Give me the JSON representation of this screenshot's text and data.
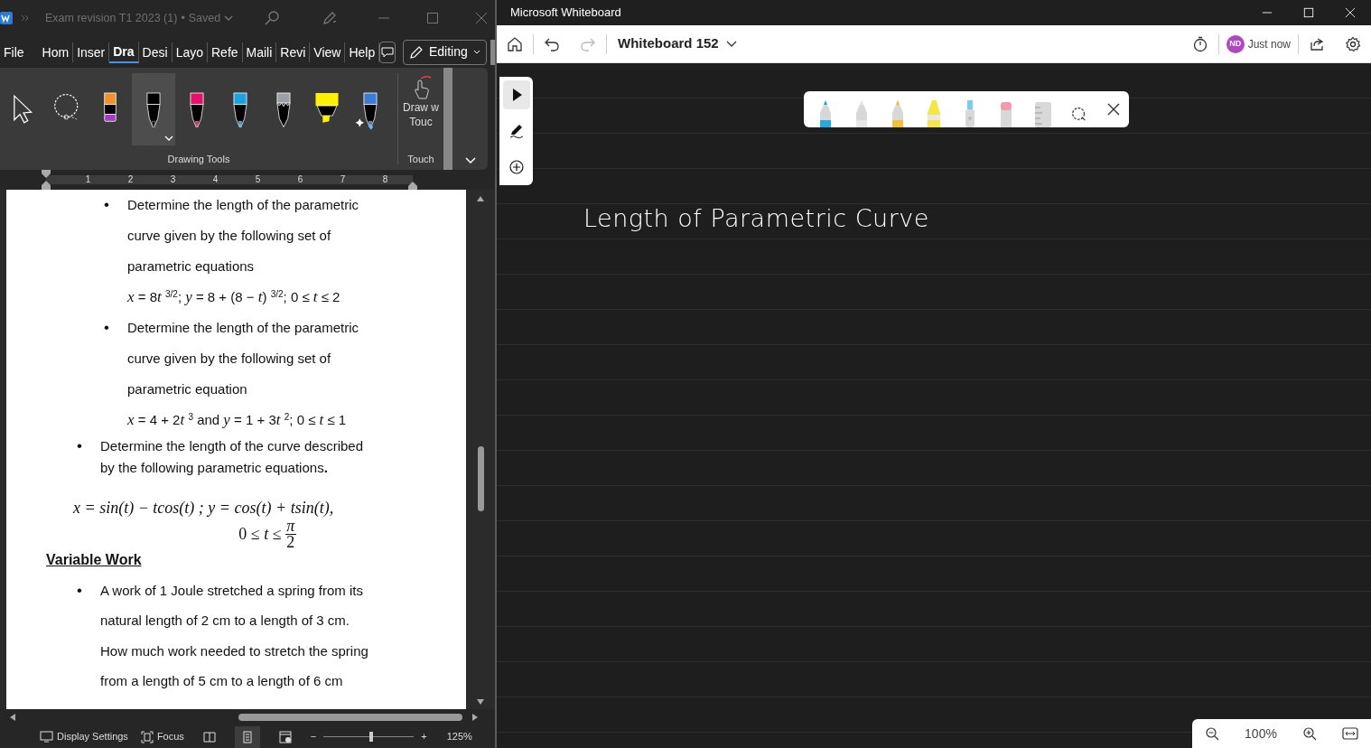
{
  "word": {
    "title": "Exam revision T1 2023 (1)",
    "separator": "•",
    "save_state": "Saved",
    "tabs": [
      {
        "label": "File",
        "selected": false
      },
      {
        "label": "Hom",
        "selected": false
      },
      {
        "label": "Inser",
        "selected": false
      },
      {
        "label": "Dra",
        "selected": true
      },
      {
        "label": "Desi",
        "selected": false
      },
      {
        "label": "Layo",
        "selected": false
      },
      {
        "label": "Refe",
        "selected": false
      },
      {
        "label": "Maili",
        "selected": false
      },
      {
        "label": "Revi",
        "selected": false
      },
      {
        "label": "View",
        "selected": false
      },
      {
        "label": "Help",
        "selected": false
      }
    ],
    "editing_button": "Editing",
    "tools": [
      {
        "kind": "select",
        "selected": false
      },
      {
        "kind": "lasso",
        "selected": false
      },
      {
        "kind": "eraser",
        "selected": false
      },
      {
        "kind": "pen",
        "color": "#000000",
        "selected": true
      },
      {
        "kind": "pen",
        "color": "#e8106a",
        "selected": false
      },
      {
        "kind": "pen",
        "color": "#1aa3e0",
        "selected": false
      },
      {
        "kind": "pencil",
        "color": "#9aa0a6",
        "selected": false
      },
      {
        "kind": "highlighter",
        "color": "#fff200",
        "selected": false
      },
      {
        "kind": "action_pen",
        "color": "#3a7bd5",
        "selected": false
      }
    ],
    "drawing_tools_label": "Drawing Tools",
    "touch_button_lines": [
      "Draw w",
      "Touc"
    ],
    "touch_group_label": "Touch",
    "ruler_numbers": [
      "1",
      "2",
      "3",
      "4",
      "5",
      "6",
      "7",
      "8"
    ],
    "document": [
      {
        "kind": "sublist",
        "items": [
          {
            "bullet": "•",
            "lines": [
              "Determine the length of the parametric",
              "curve given by the following set of",
              "parametric equations",
              [
                {
                  "text": "x",
                  "italic": true
                },
                {
                  "text": " = 8"
                },
                {
                  "text": "t ",
                  "italic": true
                },
                {
                  "text": "3/2",
                  "raised": true
                },
                {
                  "text": "; "
                },
                {
                  "text": "y",
                  "italic": true
                },
                {
                  "text": " = 8 + (8 − "
                },
                {
                  "text": "t",
                  "italic": true
                },
                {
                  "text": ") "
                },
                {
                  "text": "3/2",
                  "raised": true
                },
                {
                  "text": "; 0 ≤ "
                },
                {
                  "text": "t",
                  "italic": true
                },
                {
                  "text": " ≤ 2"
                }
              ]
            ]
          },
          {
            "bullet": "•",
            "lines": [
              "Determine the length of the parametric",
              "curve given by the following set of",
              "parametric equation",
              [
                {
                  "text": "x",
                  "italic": true
                },
                {
                  "text": " = 4 + 2"
                },
                {
                  "text": "t ",
                  "italic": true
                },
                {
                  "text": "3",
                  "raised": true
                },
                {
                  "text": " and "
                },
                {
                  "text": "y",
                  "italic": true
                },
                {
                  "text": " = 1 + 3"
                },
                {
                  "text": "t ",
                  "italic": true
                },
                {
                  "text": "2",
                  "raised": true
                },
                {
                  "text": "; 0 ≤ "
                },
                {
                  "text": "t",
                  "italic": true
                },
                {
                  "text": " ≤ 1"
                }
              ]
            ]
          }
        ]
      },
      {
        "kind": "compact_bullet",
        "bullet": "•",
        "lines": [
          "Determine the length of the curve described",
          "by the following parametric equations**.**"
        ]
      },
      {
        "kind": "equation",
        "line": "*x* = *sin*(*t*) − *tcos*(*t*) ;  *y* = *cos*(*t*) + *tsin*(*t*),",
        "range": "0 ≤ *t* ≤",
        "numerator": "π",
        "denominator": "2"
      },
      {
        "kind": "heading",
        "text": "Variable Work"
      },
      {
        "kind": "bullet",
        "bullet": "•",
        "lines": [
          "A work of 1 Joule stretched a spring from its",
          "natural length of 2 cm to a length of 3 cm.",
          "How much work needed to stretch the spring",
          "from a length of 5 cm to a length of 6 cm"
        ]
      }
    ],
    "status": {
      "display_settings": "Display Settings",
      "focus": "Focus",
      "views": [
        {
          "kind": "read",
          "selected": false
        },
        {
          "kind": "print",
          "selected": true
        },
        {
          "kind": "web",
          "selected": false
        }
      ],
      "zoom_out": "−",
      "zoom_in": "+",
      "zoom": {
        "level": 0.53
      },
      "zoom_text": "125%"
    }
  },
  "whiteboard": {
    "title": "Microsoft Whiteboard",
    "board_name": "Whiteboard 152",
    "history": [
      {
        "kind": "undo",
        "disabled": false
      },
      {
        "kind": "redo",
        "disabled": true
      }
    ],
    "avatar": "ND",
    "saved": "Just now",
    "side_tools": [
      {
        "kind": "select",
        "selected": true
      },
      {
        "kind": "pen",
        "selected": false
      },
      {
        "kind": "add",
        "selected": false
      }
    ],
    "tray": [
      {
        "kind": "pen",
        "color": "#29a8e0"
      },
      {
        "kind": "pen",
        "color": "#e6e6e6"
      },
      {
        "kind": "pen",
        "color": "#f2c230"
      },
      {
        "kind": "highlighter",
        "color": "#f5e642"
      },
      {
        "kind": "dropper",
        "color": "#7ccbee"
      },
      {
        "kind": "eraser",
        "color": "#f29ab0"
      },
      {
        "kind": "ruler"
      },
      {
        "kind": "lasso"
      }
    ],
    "ink_text": "Length of Parametric Curve",
    "zoom_text": "100%"
  }
}
